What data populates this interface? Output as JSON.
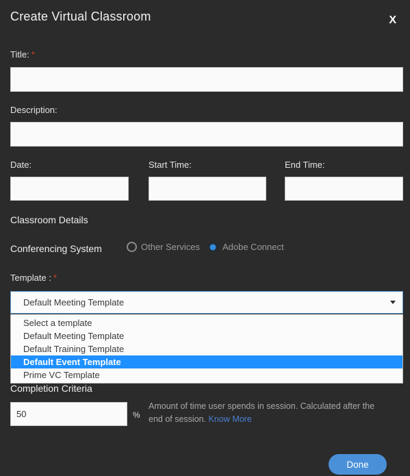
{
  "dialog": {
    "title": "Create Virtual Classroom",
    "close_label": "X"
  },
  "fields": {
    "title": {
      "label": "Title:",
      "required_marker": "*",
      "value": "",
      "placeholder": ""
    },
    "description": {
      "label": "Description:",
      "value": "",
      "placeholder": ""
    },
    "date": {
      "label": "Date:",
      "value": "",
      "placeholder": ""
    },
    "start_time": {
      "label": "Start Time:",
      "value": "",
      "placeholder": ""
    },
    "end_time": {
      "label": "End Time:",
      "value": "",
      "placeholder": ""
    }
  },
  "classroom_details": {
    "heading": "Classroom Details",
    "conferencing_system": {
      "label": "Conferencing System",
      "options": [
        {
          "label": "Other Services",
          "selected": false
        },
        {
          "label": "Adobe Connect",
          "selected": true
        }
      ]
    },
    "template": {
      "label": "Template :",
      "required_marker": "*",
      "selected_value": "Default Meeting Template",
      "expanded": true,
      "arrow_icon": "chevron-down-icon",
      "options": [
        {
          "label": "Select a template",
          "highlighted": false
        },
        {
          "label": "Default Meeting Template",
          "highlighted": false
        },
        {
          "label": "Default Training Template",
          "highlighted": false
        },
        {
          "label": "Default Event Template",
          "highlighted": true
        },
        {
          "label": "Prime VC Template",
          "highlighted": false
        }
      ]
    }
  },
  "completion_criteria": {
    "heading": "Completion Criteria",
    "value": "50",
    "unit": "%",
    "help_text": "Amount of time user spends in session. Calculated after the end of session.",
    "link_label": "Know More"
  },
  "footer": {
    "done_label": "Done"
  },
  "colors": {
    "background": "#2b2b2b",
    "accent_blue": "#4a90d9",
    "highlight_blue": "#1e90ff",
    "required_red": "#cc4125",
    "link_blue": "#4a7fd0",
    "input_background": "#fafafa"
  }
}
